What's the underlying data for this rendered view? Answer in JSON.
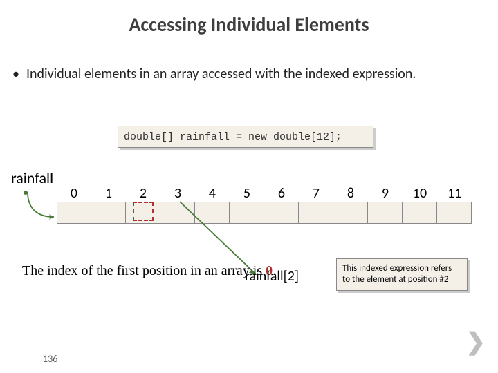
{
  "title": "Accessing Individual Elements",
  "bullet": "Individual elements in an array accessed with the indexed expression.",
  "code": "double[] rainfall = new double[12];",
  "label_rainfall": "rainfall",
  "indices": [
    "0",
    "1",
    "2",
    "3",
    "4",
    "5",
    "6",
    "7",
    "8",
    "9",
    "10",
    "11"
  ],
  "caption_left_prefix": "The index of the first position in an array is ",
  "caption_left_zero": "0",
  "caption_left_suffix": ".",
  "indexed_expr": "rainfall[2]",
  "note": "This indexed expression refers to the element at position #2",
  "page_number": "136",
  "chevron": "❯"
}
